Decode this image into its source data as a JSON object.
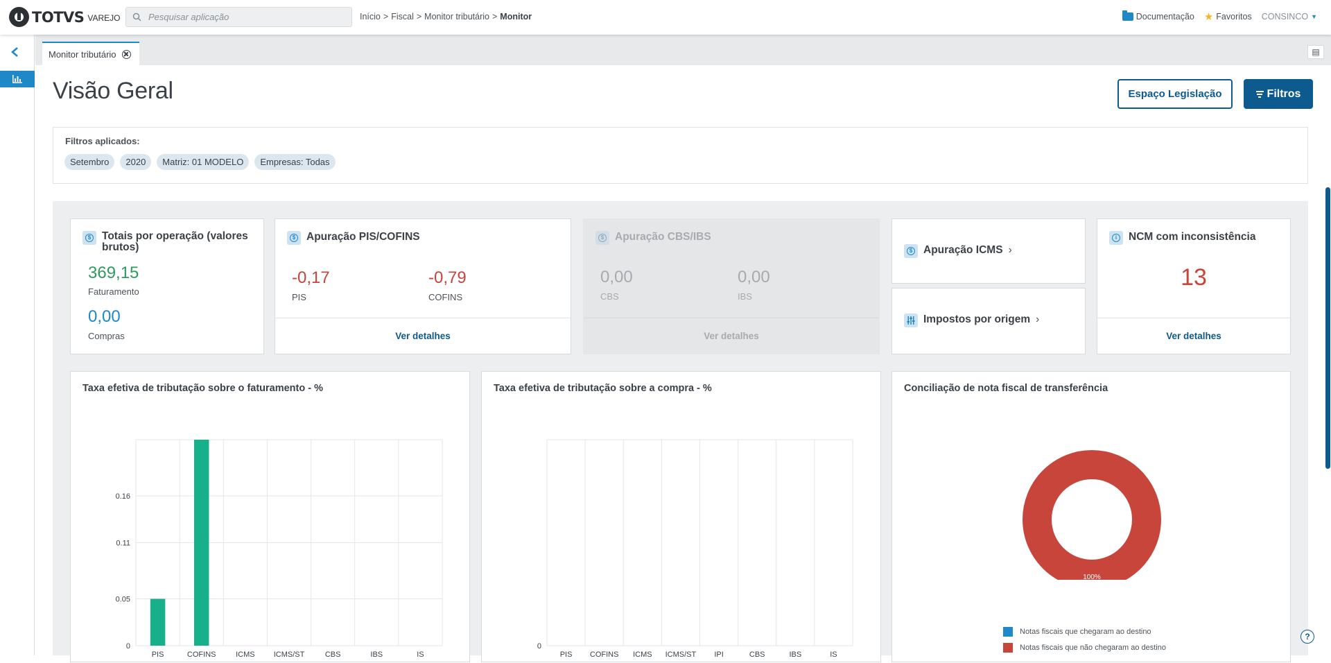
{
  "header": {
    "logo_text": "TOTVS",
    "logo_sub": "VAREJO",
    "search_placeholder": "Pesquisar aplicação",
    "breadcrumb": [
      "Início",
      "Fiscal",
      "Monitor tributário",
      "Monitor"
    ],
    "docs_label": "Documentação",
    "favorites_label": "Favoritos",
    "user_label": "CONSINCO"
  },
  "tab": {
    "label": "Monitor tributário"
  },
  "page": {
    "title": "Visão Geral",
    "btn_legislacao": "Espaço Legislação",
    "btn_filtros": "Filtros"
  },
  "filters": {
    "label": "Filtros aplicados:",
    "chips": [
      "Setembro",
      "2020",
      "Matriz: 01 MODELO",
      "Empresas: Todas"
    ]
  },
  "cards": {
    "totais": {
      "title": "Totais por operação (valores brutos)",
      "faturamento_value": "369,15",
      "faturamento_label": "Faturamento",
      "compras_value": "0,00",
      "compras_label": "Compras"
    },
    "pis_cofins": {
      "title": "Apuração PIS/COFINS",
      "pis_value": "-0,17",
      "pis_label": "PIS",
      "cofins_value": "-0,79",
      "cofins_label": "COFINS",
      "link": "Ver detalhes"
    },
    "cbs_ibs": {
      "title": "Apuração CBS/IBS",
      "cbs_value": "0,00",
      "cbs_label": "CBS",
      "ibs_value": "0,00",
      "ibs_label": "IBS",
      "link": "Ver detalhes"
    },
    "icms": {
      "title": "Apuração ICMS"
    },
    "impostos": {
      "title": "Impostos por origem"
    },
    "ncm": {
      "title": "NCM com inconsistência",
      "value": "13",
      "link": "Ver detalhes"
    }
  },
  "chart_data": [
    {
      "type": "bar",
      "title": "Taxa efetiva de tributação sobre o faturamento - %",
      "categories": [
        "PIS",
        "COFINS",
        "ICMS",
        "ICMS/ST",
        "CBS",
        "IBS",
        "IS"
      ],
      "values": [
        0.05,
        0.22,
        0,
        0,
        0,
        0,
        0
      ],
      "yticks": [
        "0",
        "0.05",
        "0.11",
        "0.16"
      ],
      "ylim": [
        0,
        0.22
      ],
      "grid": true,
      "color": "#17b08a"
    },
    {
      "type": "bar",
      "title": "Taxa efetiva de tributação sobre a compra - %",
      "categories": [
        "PIS",
        "COFINS",
        "ICMS",
        "ICMS/ST",
        "IPI",
        "CBS",
        "IBS",
        "IS"
      ],
      "values": [
        0,
        0,
        0,
        0,
        0,
        0,
        0,
        0
      ],
      "yticks": [
        "0"
      ],
      "grid": true
    },
    {
      "type": "pie",
      "title": "Conciliação de nota fiscal de transferência",
      "slices": [
        {
          "label": "Notas fiscais que chegaram ao destino",
          "value": 0,
          "color": "#1f88c6"
        },
        {
          "label": "Notas fiscais que não chegaram ao destino",
          "value": 100,
          "color": "#c8453b"
        }
      ],
      "center_label": "100%",
      "legend": "bottom"
    }
  ],
  "help_label": "?"
}
